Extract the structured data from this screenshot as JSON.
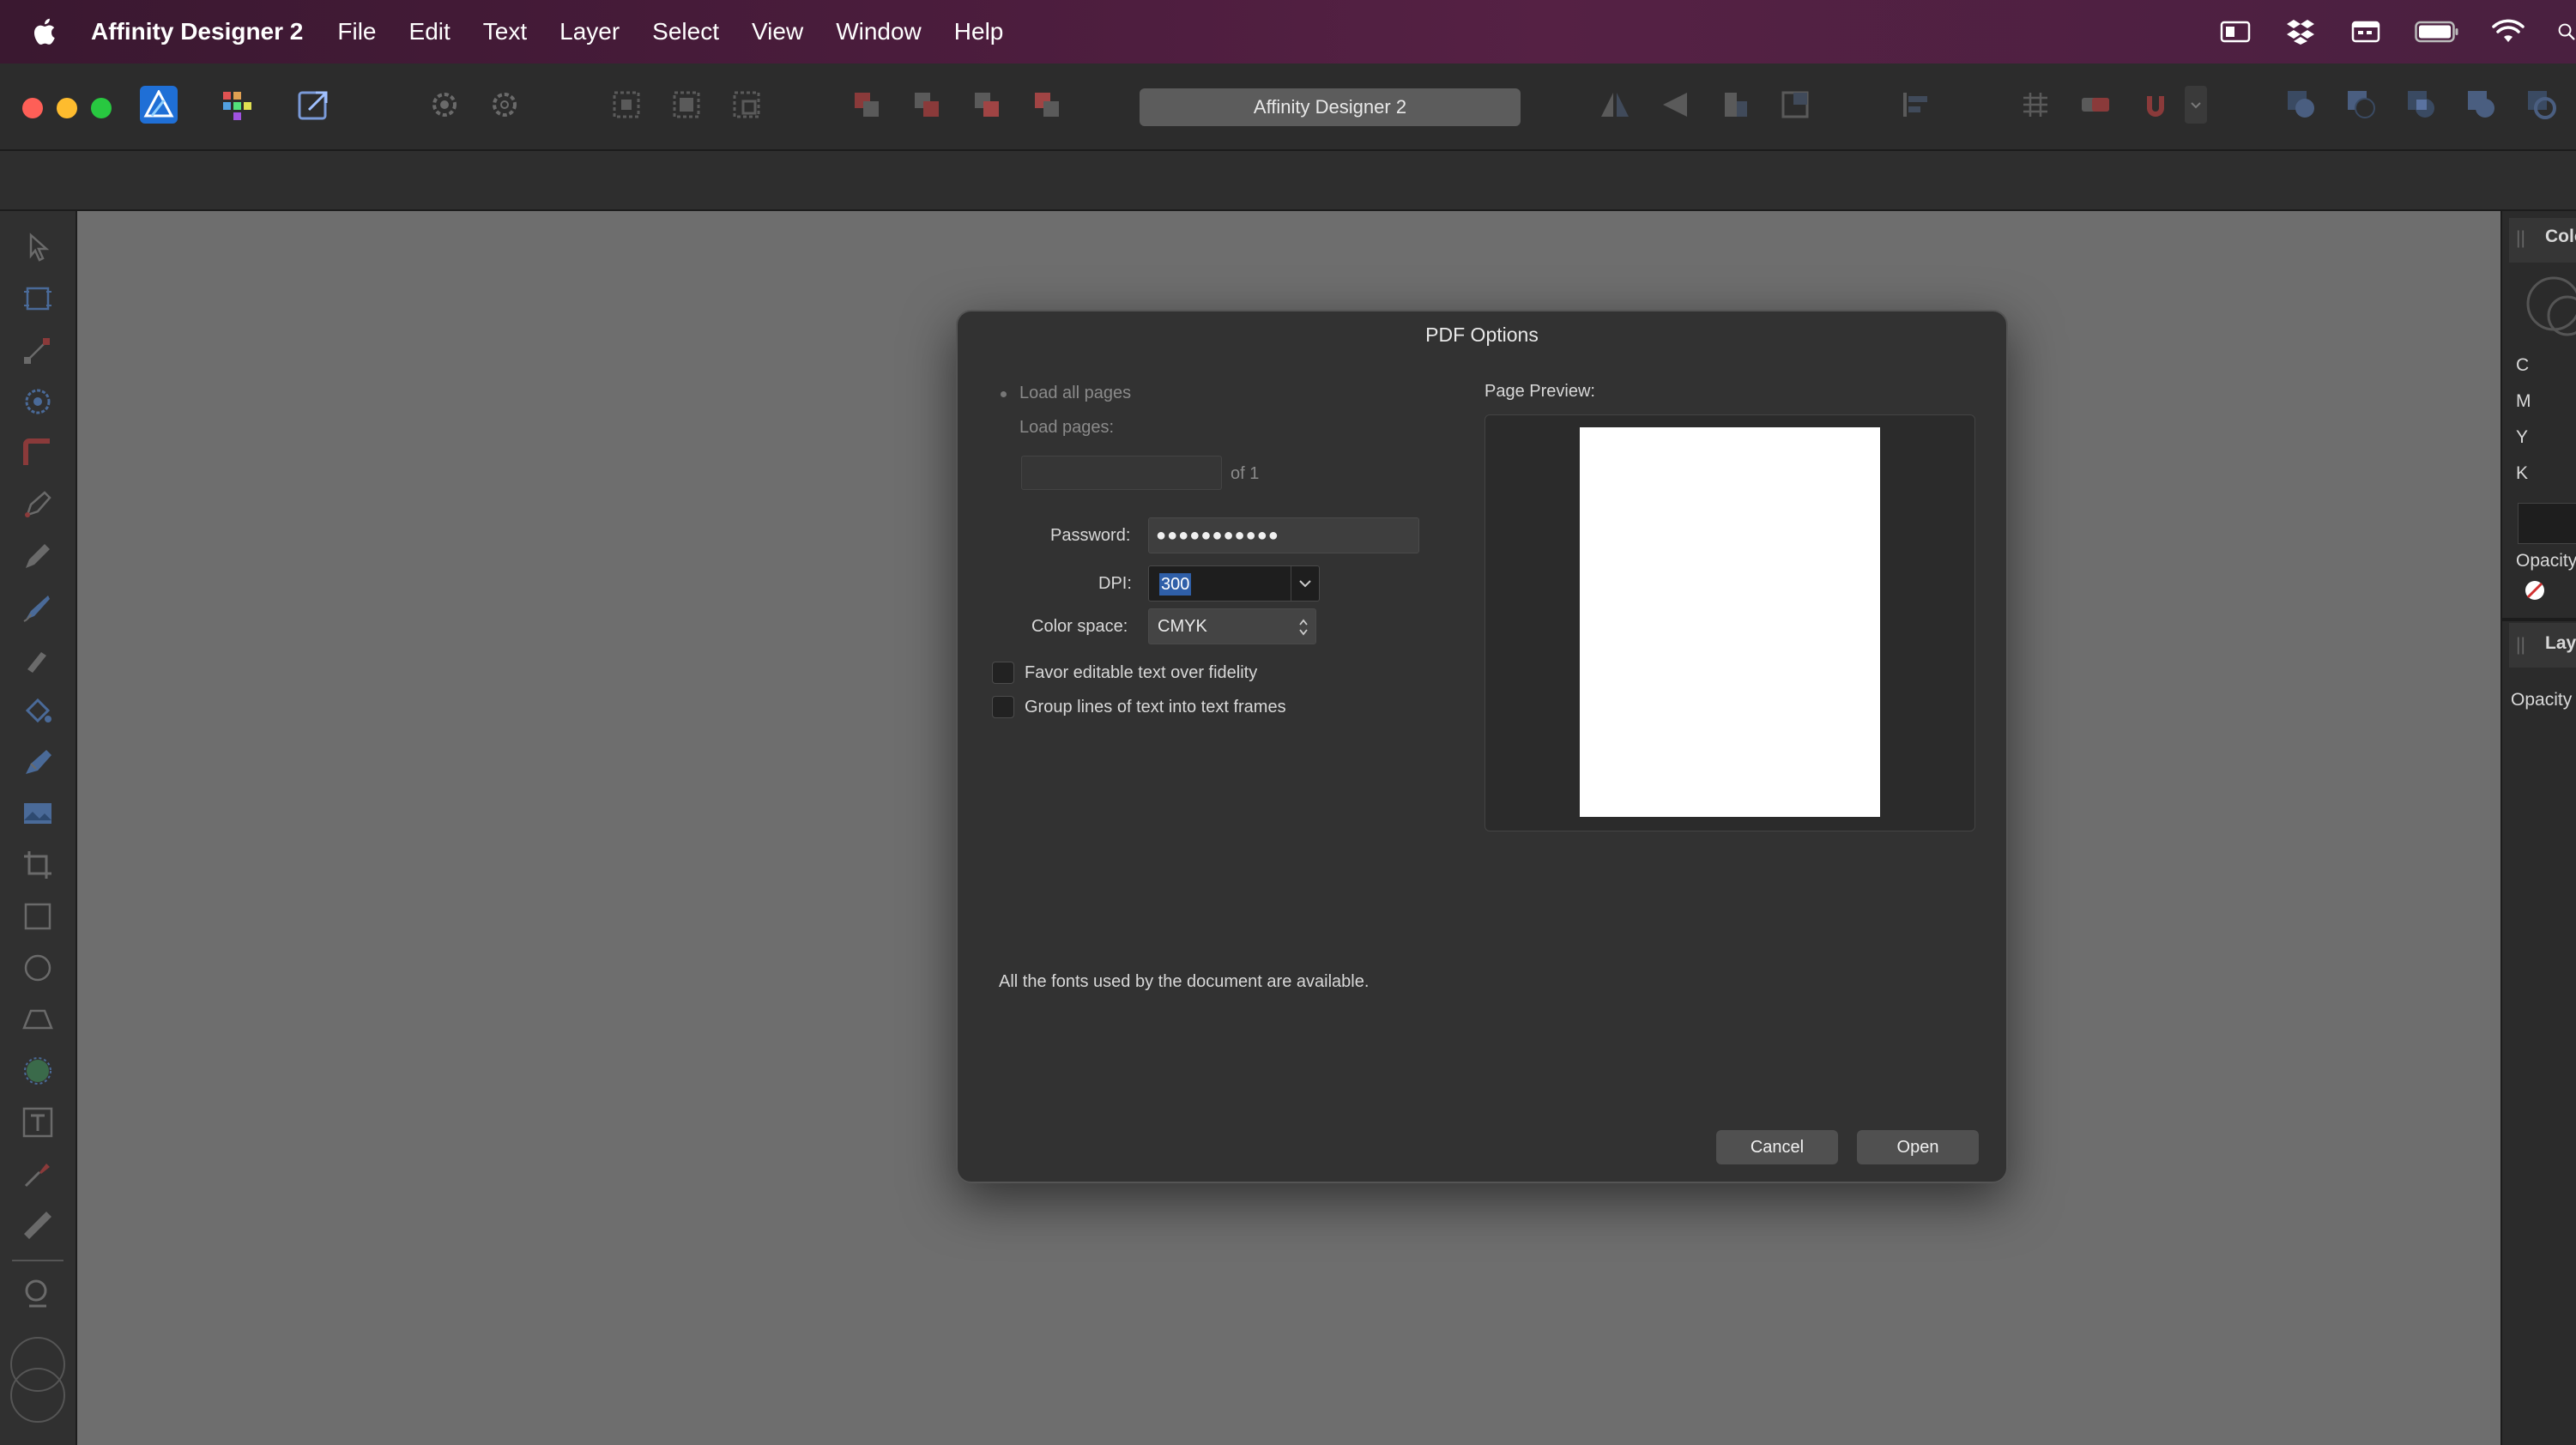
{
  "menubar": {
    "app_name": "Affinity Designer 2",
    "items": [
      "File",
      "Edit",
      "Text",
      "Layer",
      "Select",
      "View",
      "Window",
      "Help"
    ],
    "status_icons": [
      "display-icon",
      "dropbox-icon",
      "calendar-icon",
      "battery-icon",
      "wifi-icon",
      "spotlight-icon"
    ]
  },
  "toolbar": {
    "title": "Affinity Designer 2"
  },
  "right_panel": {
    "color_tab": "Colo",
    "channels": [
      "C",
      "M",
      "Y",
      "K"
    ],
    "opacity_label": "Opacity",
    "layers_tab": "Laye",
    "layers_opacity": "Opacity"
  },
  "dialog": {
    "title": "PDF Options",
    "load_all_pages": "Load all pages",
    "load_pages": "Load pages:",
    "of_pages": "of 1",
    "password_label": "Password:",
    "password_value": "●●●●●●●●●●●",
    "dpi_label": "DPI:",
    "dpi_value": "300",
    "color_space_label": "Color space:",
    "color_space_value": "CMYK",
    "favor_editable": "Favor editable text over fidelity",
    "group_lines": "Group lines of text into text frames",
    "page_preview_label": "Page Preview:",
    "fonts_status": "All the fonts used by the document are available.",
    "cancel": "Cancel",
    "open": "Open"
  },
  "colors": {
    "accent_blue": "#1f6fd6",
    "canvas_gray": "#6e6e6e",
    "dialog_bg": "#323232"
  }
}
